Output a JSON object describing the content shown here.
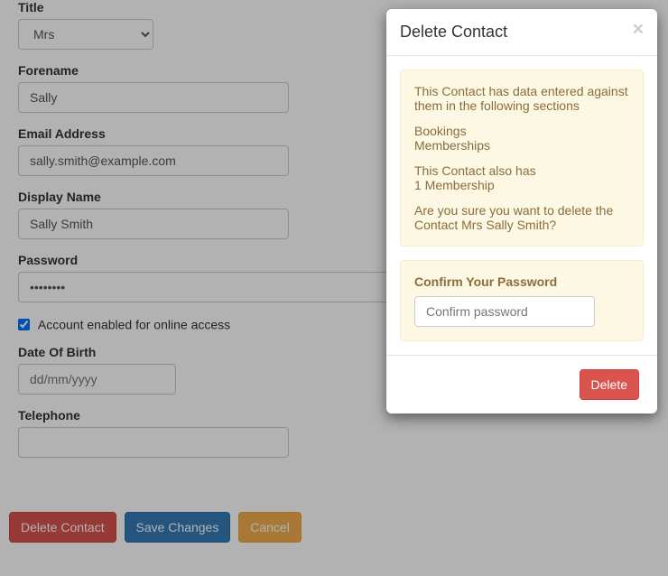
{
  "form": {
    "title": {
      "label": "Title",
      "value": "Mrs"
    },
    "forename": {
      "label": "Forename",
      "value": "Sally"
    },
    "email": {
      "label": "Email Address",
      "value": "sally.smith@example.com"
    },
    "displayName": {
      "label": "Display Name",
      "value": "Sally Smith"
    },
    "password": {
      "label": "Password",
      "value": "••••••••"
    },
    "accountEnabled": {
      "label": "Account enabled for online access",
      "checked": true
    },
    "dob": {
      "label": "Date Of Birth",
      "placeholder": "dd/mm/yyyy"
    },
    "telephone": {
      "label": "Telephone",
      "value": ""
    }
  },
  "buttons": {
    "deleteContact": "Delete Contact",
    "saveChanges": "Save Changes",
    "cancel": "Cancel"
  },
  "modal": {
    "title": "Delete Contact",
    "warning": {
      "intro": "This Contact has data entered against them in the following sections",
      "section1": "Bookings",
      "section2": "Memberships",
      "also": "This Contact also has",
      "membership": "1 Membership",
      "confirm": "Are you sure you want to delete the Contact Mrs Sally Smith?"
    },
    "confirmPassword": {
      "label": "Confirm Your Password",
      "placeholder": "Confirm password"
    },
    "deleteButton": "Delete"
  }
}
